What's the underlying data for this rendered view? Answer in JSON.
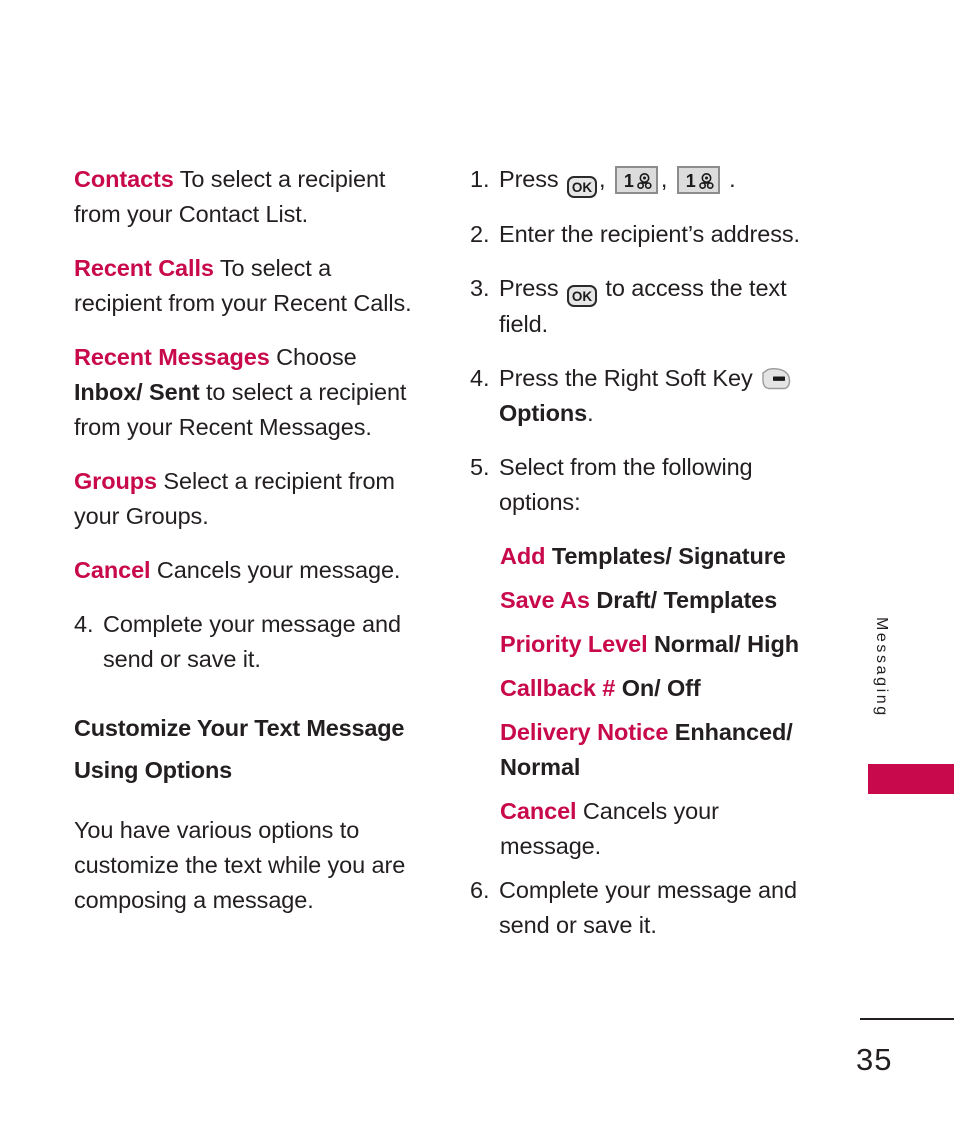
{
  "page": {
    "number": "35",
    "side_tab_label": "Messaging",
    "accent_color": "#c8094b",
    "text_color": "#231f20"
  },
  "left_column": {
    "blocks": [
      {
        "term": "Contacts",
        "text": "  To select a recipient from your Contact List."
      },
      {
        "term": "Recent Calls",
        "text": " To select a recipient from your Recent Calls."
      },
      {
        "term": "Recent Messages",
        "text_before": " Choose ",
        "bold_term": "Inbox/ Sent",
        "text_after": " to select a recipient from your Recent Messages."
      },
      {
        "term": "Groups",
        "text": " Select a recipient from your Groups."
      },
      {
        "term": "Cancel",
        "text": "  Cancels your message."
      }
    ],
    "step": {
      "num": "4.",
      "text": "Complete your message and send or save it."
    },
    "heading": "Customize Your Text Message Using Options",
    "body": "You have various options to customize the text while you are composing a message."
  },
  "right_column": {
    "steps": [
      {
        "num": "1.",
        "text_before": "Press ",
        "keys": [
          "ok-key",
          "one-voicemail-key",
          "one-voicemail-key"
        ],
        "separator": ", ",
        "text_after": " ."
      },
      {
        "num": "2.",
        "text": "Enter the recipient’s address."
      },
      {
        "num": "3.",
        "text_before": "Press ",
        "key": "ok-key",
        "text_after": " to access the text field."
      },
      {
        "num": "4.",
        "text_before": "Press the Right Soft Key ",
        "key": "right-soft-key",
        "bold_after": "Options",
        "text_end": "."
      },
      {
        "num": "5.",
        "text": "Select from the following options:"
      }
    ],
    "options": [
      {
        "term": "Add",
        "values": "Templates/ Signature",
        "bold": true
      },
      {
        "term": "Save As",
        "values": "  Draft/ Templates",
        "bold": true
      },
      {
        "term": "Priority Level",
        "values": "Normal/ High",
        "bold": true
      },
      {
        "term": "Callback #",
        "values": "On/ Off",
        "bold": true
      },
      {
        "term": "Delivery Notice",
        "values": "Enhanced/ Normal",
        "bold": true
      },
      {
        "term": "Cancel",
        "values": "Cancels your message.",
        "bold": false
      }
    ],
    "final_step": {
      "num": "6.",
      "text": "Complete your message and send or save it."
    }
  },
  "icons": {
    "ok_key_label": "OK",
    "one_key_digit": "1"
  }
}
